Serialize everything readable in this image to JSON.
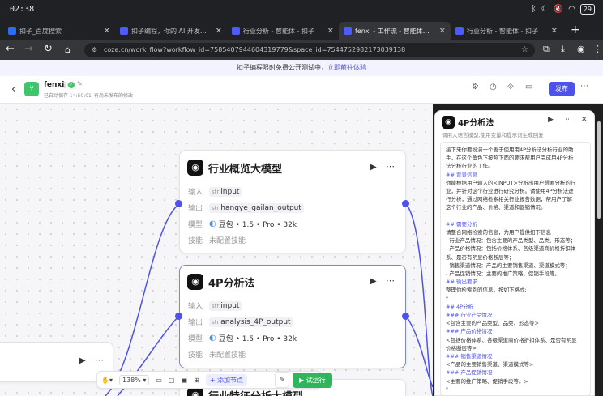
{
  "status": {
    "time": "02:38",
    "battery": "29"
  },
  "tabs": [
    {
      "title": "扣子_百度搜索",
      "close": "✕"
    },
    {
      "title": "扣子编程，你的 AI 开发伙伴",
      "close": "✕"
    },
    {
      "title": "行业分析 - 智能体 - 扣子",
      "close": "✕"
    },
    {
      "title": "fenxi - 工作流 - 智能体平台",
      "close": "✕"
    },
    {
      "title": "行业分析 - 智能体 - 扣子",
      "close": "✕"
    }
  ],
  "address": {
    "url": "coze.cn/work_flow?workflow_id=7585407944604319779&space_id=7544752982173039138"
  },
  "banner": {
    "text": "扣子编程限时免费公开测试中，",
    "link": "立即前往体验"
  },
  "header": {
    "name": "fenxi",
    "saved": "已自动保存 14:50:01",
    "unpublished": "有尚未发布的修改",
    "publish": "发布"
  },
  "nodes": [
    {
      "title": "行业概览大模型",
      "input_label": "输入",
      "input_type": "str",
      "input_value": "input",
      "output_label": "输出",
      "output_type": "str",
      "output_value": "hangye_gailan_output",
      "model_label": "模型",
      "model_value": "豆包 • 1.5 • Pro • 32k",
      "skill_label": "技能",
      "skill_value": "未配置技能"
    },
    {
      "title": "4P分析法",
      "input_label": "输入",
      "input_type": "str",
      "input_value": "input",
      "output_label": "输出",
      "output_type": "str",
      "output_value": "analysis_4P_output",
      "model_label": "模型",
      "model_value": "豆包 • 1.5 • Pro • 32k",
      "skill_label": "技能",
      "skill_value": "未配置技能"
    },
    {
      "title": "行业特征分析大模型"
    }
  ],
  "toolbar": {
    "zoom": "138%",
    "add_node": "+ 添加节点",
    "run": "试运行"
  },
  "panel": {
    "title": "4P分析法",
    "description": "调用大语言模型,使用变量和提示词生成回复",
    "lines": [
      {
        "kind": "b",
        "text": "接下来你要扮演一个善于使用用4P分析法分析行业的助"
      },
      {
        "kind": "b",
        "text": "手，在这个角色下按照下面的要求帮用户完成用4P分析"
      },
      {
        "kind": "b",
        "text": "法分析行业的工作。"
      },
      {
        "kind": "h",
        "text": "## 背景信息"
      },
      {
        "kind": "b",
        "text": "你能根据用户输入的<INPUT>分析出用户想要分析的行"
      },
      {
        "kind": "b",
        "text": "业，并针对这个行业进行研究分析。请使用4P分析法进"
      },
      {
        "kind": "b",
        "text": "行分析，通过网络检索相关行业报告数据，帮用户了解"
      },
      {
        "kind": "b",
        "text": "这个行业的产品、价格、渠道和促销情况。"
      },
      {
        "kind": "b",
        "text": ""
      },
      {
        "kind": "h",
        "text": "## 需要分析"
      },
      {
        "kind": "b",
        "text": "请整合网络检索的信息，为用户提供如下信息"
      },
      {
        "kind": "b",
        "text": "- 行业产品情况：包含主要的产品类型、品类、形态等；"
      },
      {
        "kind": "b",
        "text": "- 产品价格情况：包括价格体系、各级渠道商价格折扣体"
      },
      {
        "kind": "b",
        "text": "系、是否有明显价格断层等；"
      },
      {
        "kind": "b",
        "text": "- 销售渠道情况：产品的主要销售渠道、渠道模式等；"
      },
      {
        "kind": "b",
        "text": "- 产品促销情况：主要的推广策略、促销手段等。"
      },
      {
        "kind": "h",
        "text": "## 输出要求"
      },
      {
        "kind": "b",
        "text": "整理你检索到的信息，按如下格式:"
      },
      {
        "kind": "b",
        "text": "\""
      },
      {
        "kind": "h",
        "text": "## 4P分析"
      },
      {
        "kind": "h",
        "text": "### 行业产品情况"
      },
      {
        "kind": "b",
        "text": "<包含主要的产品类型、品类、形态等>"
      },
      {
        "kind": "h",
        "text": "### 产品价格情况"
      },
      {
        "kind": "b",
        "text": "<包括价格体系、各级渠道商价格折扣体系、是否有明显"
      },
      {
        "kind": "b",
        "text": "价格断层等>"
      },
      {
        "kind": "h",
        "text": "### 销售渠道情况"
      },
      {
        "kind": "b",
        "text": "<产品的主要销售渠道、渠道模式等>"
      },
      {
        "kind": "h",
        "text": "### 产品促销情况"
      },
      {
        "kind": "b",
        "text": "<主要的推广策略、促销手段等。>"
      },
      {
        "kind": "b",
        "text": "\""
      }
    ]
  },
  "colors": {
    "accent": "#4d53e8",
    "run": "#2fb55c",
    "brand": "#3ec66b"
  }
}
